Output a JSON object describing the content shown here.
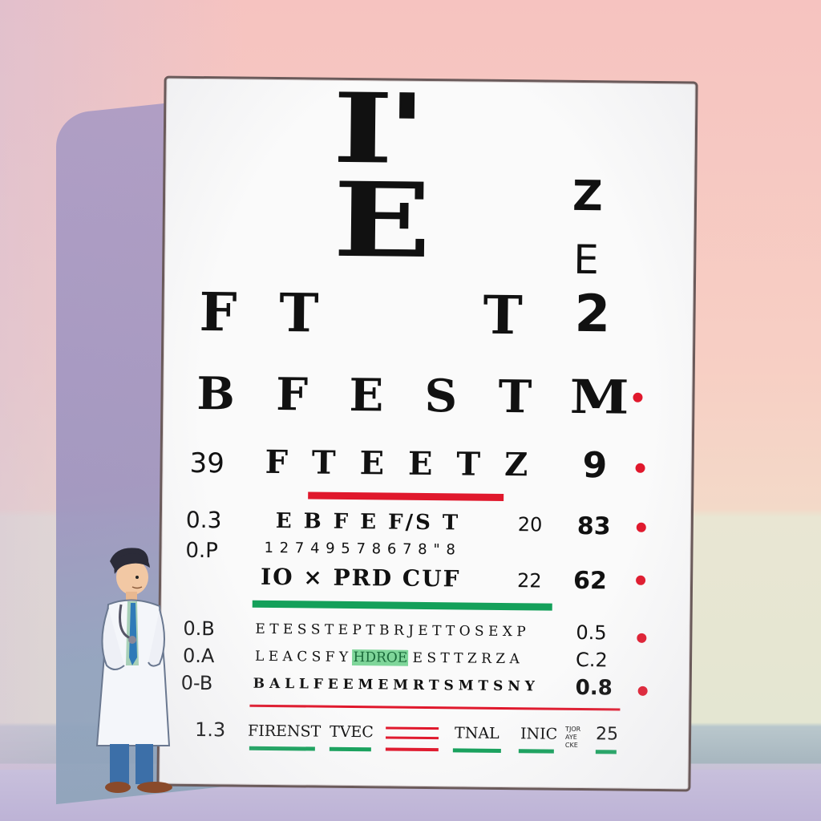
{
  "chart": {
    "row1": "I'",
    "row2": "E",
    "side_z": "Z",
    "side_e": "E",
    "row3_left": "F T",
    "row3_mid": "T",
    "row3_right": "2",
    "row4": "B F E S T",
    "row4_right": "M",
    "row5_left": "39",
    "row5": "F T E E T Z",
    "row5_right": "9",
    "row6_left": "0.3",
    "row6": "E B F E F/S T",
    "row6_num": "20",
    "row6_right": "83",
    "row7_left": "0.P",
    "row7": "1 2 7 4 9 5 7 8 6 7 8 \" 8",
    "row8": "IO × PRD CUF",
    "row8_num": "22",
    "row8_right": "62",
    "row9_left": "0.B",
    "row9": "E T E S S T E P T B R J E T T O S E X P",
    "row9_right": "0.5",
    "row10_left": "0.A",
    "row10_a": "L E A C S F Y",
    "row10_green": "HDROE",
    "row10_b": "E S T T Z R Z A",
    "row10_right": "C.2",
    "row11_left": "0-B",
    "row11": "B A L L F E E M E M R T S M T S N Y",
    "row11_right": "0.8",
    "foot_left": "1.3",
    "foot_1": "FIRENST",
    "foot_2": "TVEC",
    "foot_3": "TNAL",
    "foot_4": "INIC",
    "foot_small_1": "TJOR",
    "foot_small_2": "AYE",
    "foot_small_3": "CKE",
    "foot_right": "25"
  },
  "colors": {
    "red": "#e0182c",
    "green": "#14a05a",
    "ink": "#111111"
  }
}
